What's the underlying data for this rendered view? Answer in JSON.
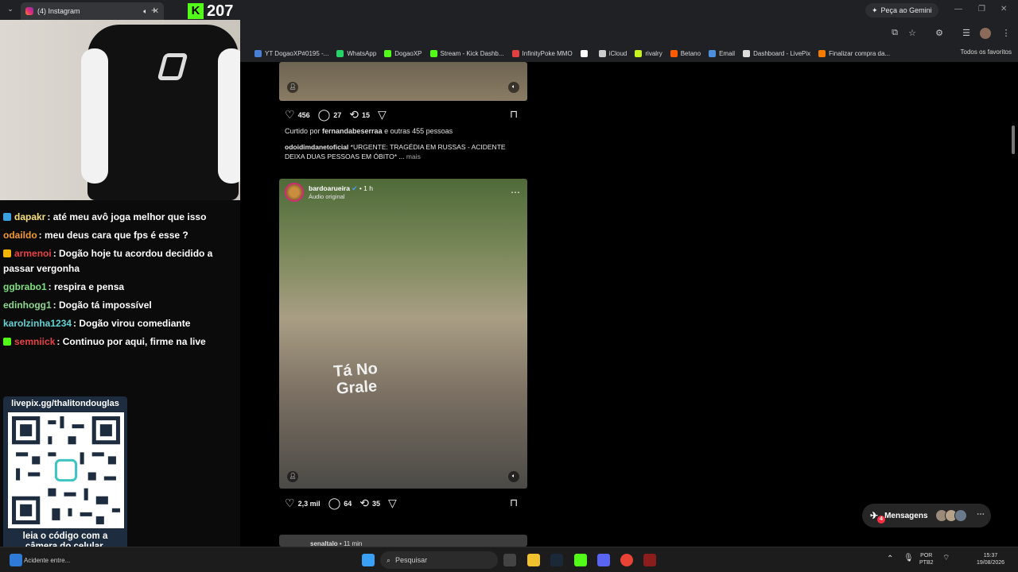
{
  "browser": {
    "tab_title": "(4) Instagram",
    "gemini_button": "Peça ao Gemini",
    "bookmarks": [
      {
        "label": "YT DogaoXP#0195 -...",
        "color": "#4a7fd8"
      },
      {
        "label": "WhatsApp",
        "color": "#25d366"
      },
      {
        "label": "DogaoXP",
        "color": "#53fc18"
      },
      {
        "label": "Stream - Kick Dashb...",
        "color": "#53fc18"
      },
      {
        "label": "InfinityPoke MMO",
        "color": "#e04040"
      },
      {
        "label": "",
        "color": "#ffffff"
      },
      {
        "label": "iCloud",
        "color": "#cccccc"
      },
      {
        "label": "rivalry",
        "color": "#c6f21f"
      },
      {
        "label": "Betano",
        "color": "#ff5a00"
      },
      {
        "label": "Email",
        "color": "#4a8fe0"
      },
      {
        "label": "Dashboard - LivePix",
        "color": "#dddddd"
      },
      {
        "label": "Finalizar compra da...",
        "color": "#f57c00"
      }
    ],
    "all_bookmarks": "Todos os favoritos"
  },
  "stream": {
    "viewer_count": "207",
    "chat": [
      {
        "user": "dapakr",
        "text": ": até meu avô joga melhor que isso",
        "color": "#f6e07a",
        "badge_color": "#3aa0e0"
      },
      {
        "user": "odaildo",
        "text": ": meu deus cara que fps é esse ?",
        "color": "#f39a2e",
        "badge_color": ""
      },
      {
        "user": "armenoi",
        "text": ": Dogão hoje tu acordou decidido a passar vergonha",
        "color": "#e84242",
        "badge_color": "#f5b400"
      },
      {
        "user": "ggbrabo1",
        "text": ": respira e pensa",
        "color": "#7ee07e",
        "badge_color": ""
      },
      {
        "user": "edinhogg1",
        "text": ": Dogão tá impossível",
        "color": "#8fd68f",
        "badge_color": ""
      },
      {
        "user": "karolzinha1234",
        "text": ": Dogão virou comediante",
        "color": "#5fd3d3",
        "badge_color": ""
      },
      {
        "user": "semniick",
        "text": ": Continuo por aqui, firme na live",
        "color": "#e84242",
        "badge_color": "#53fc18"
      }
    ],
    "qr_top": "livepix.gg/thalitondouglas",
    "qr_bottom_1": "leia o código com a",
    "qr_bottom_2": "câmera do celular."
  },
  "feed": {
    "post1": {
      "likes": "456",
      "comments": "27",
      "reposts": "15",
      "liked_by_prefix": "Curtido por ",
      "liked_by_user": "fernandabeserraa",
      "liked_by_suffix": " e outras 455 pessoas",
      "caption_user": "odoidimdanetoficial",
      "caption_text": " *URGENTE: TRAGÉDIA EM RUSSAS - ACIDENTE DEIXA DUAS PESSOAS EM ÓBITO* ... ",
      "more": "mais"
    },
    "post2": {
      "username": "bardoarueira",
      "time": "• 1 h",
      "audio": "Áudio original",
      "shirt_line1": "Tá No",
      "shirt_line2": "Grale",
      "likes": "2,3 mil",
      "comments": "64",
      "reposts": "35"
    },
    "post3": {
      "username": "senaltalo",
      "time": "• 11 min"
    },
    "messages_label": "Mensagens",
    "messages_badge": "4"
  },
  "taskbar": {
    "news": "Acidente entre...",
    "search_placeholder": "Pesquisar",
    "lang_1": "POR",
    "lang_2": "PTB2",
    "time": "15:37",
    "date": "19/08/2026"
  }
}
